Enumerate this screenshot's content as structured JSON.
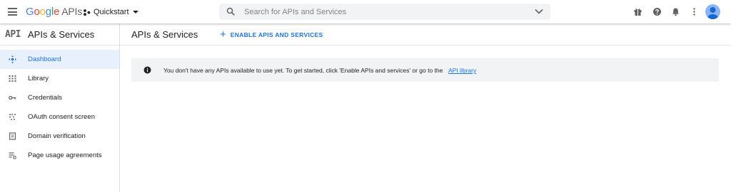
{
  "topbar": {
    "logo_letters": [
      "G",
      "o",
      "o",
      "g",
      "l",
      "e"
    ],
    "logo_suffix": "APIs",
    "project_name": "Quickstart",
    "search_placeholder": "Search for APIs and Services",
    "icons": [
      "menu-icon",
      "gift-icon",
      "help-icon",
      "notifications-icon",
      "more-vert-icon",
      "avatar"
    ]
  },
  "sidebar": {
    "mark": "API",
    "title": "APIs & Services",
    "items": [
      {
        "label": "Dashboard",
        "icon": "dashboard-icon",
        "active": true
      },
      {
        "label": "Library",
        "icon": "library-icon",
        "active": false
      },
      {
        "label": "Credentials",
        "icon": "key-icon",
        "active": false
      },
      {
        "label": "OAuth consent screen",
        "icon": "consent-icon",
        "active": false
      },
      {
        "label": "Domain verification",
        "icon": "domain-icon",
        "active": false
      },
      {
        "label": "Page usage agreements",
        "icon": "agreements-icon",
        "active": false
      }
    ]
  },
  "main": {
    "title": "APIs & Services",
    "enable_button": "ENABLE APIS AND SERVICES",
    "notice_text": "You don't have any APIs available to use yet. To get started, click 'Enable APIs and services' or go to the",
    "notice_link": "API library"
  },
  "colors": {
    "accent": "#1a73e8",
    "active_bg": "#e8f0fe",
    "notice_bg": "#f1f3f4",
    "search_bg": "#f1f3f4"
  }
}
